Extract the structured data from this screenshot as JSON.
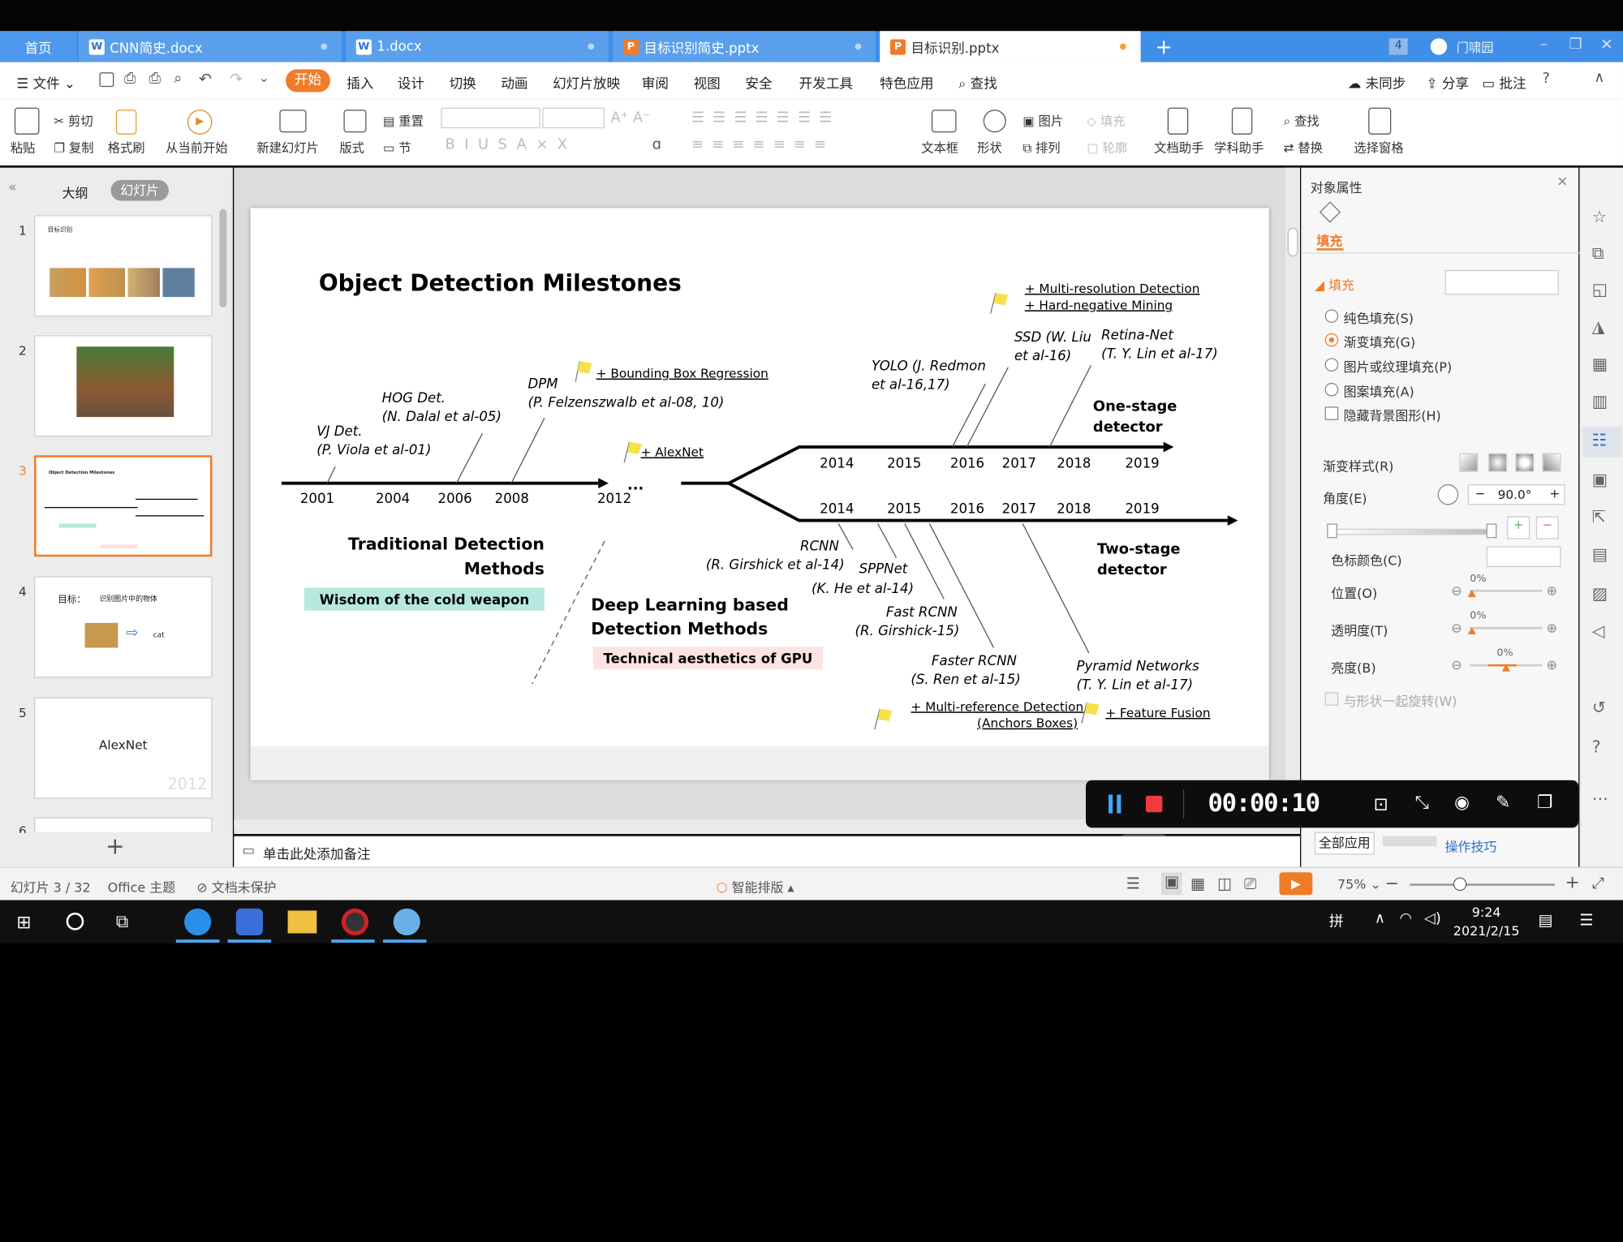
{
  "tabs": [
    {
      "label": "首页"
    },
    {
      "label": "CNN简史.docx"
    },
    {
      "label": "1.docx"
    },
    {
      "label": "目标识别简史.pptx"
    },
    {
      "label": "目标识别.pptx"
    }
  ],
  "window": {
    "tab_count": "4",
    "user": "门啸园"
  },
  "menu": [
    "文件",
    "开始",
    "插入",
    "设计",
    "切换",
    "动画",
    "幻灯片放映",
    "审阅",
    "视图",
    "安全",
    "开发工具",
    "特色应用",
    "查找"
  ],
  "menu_right": [
    "未同步",
    "分享",
    "批注"
  ],
  "ribbon": {
    "paste": "粘贴",
    "cut": "剪切",
    "copy": "复制",
    "format_brush": "格式刷",
    "from_current": "从当前开始",
    "new_slide": "新建幻灯片",
    "layout": "版式",
    "reset": "重置",
    "section": "节",
    "picture": "图片",
    "fill": "填充",
    "arrange": "排列",
    "outline": "轮廓",
    "textbox": "文本框",
    "shape": "形状",
    "doc_assist": "文档助手",
    "study_assist": "学科助手",
    "find": "查找",
    "replace": "替换",
    "select_pane": "选择窗格"
  },
  "left_panel": {
    "tab_outline": "大纲",
    "tab_slides": "幻灯片",
    "slides": [
      {
        "num": "1",
        "title": "目标识别"
      },
      {
        "num": "2",
        "title": ""
      },
      {
        "num": "3",
        "title": "Object Detection Milestones"
      },
      {
        "num": "4",
        "title": "目标：",
        "text": "识别图片中的物体",
        "label": "cat"
      },
      {
        "num": "5",
        "title": "AlexNet",
        "year": "2012"
      },
      {
        "num": "6"
      }
    ]
  },
  "slide": {
    "title": "Object Detection Milestones",
    "top_axis_years": [
      "2001",
      "2004",
      "2006",
      "2008",
      "2012",
      "..."
    ],
    "upper_branch_years": [
      "2014",
      "2015",
      "2016",
      "2017",
      "2018",
      "2019"
    ],
    "lower_branch_years": [
      "2014",
      "2015",
      "2016",
      "2017",
      "2018",
      "2019"
    ],
    "vj": [
      "VJ Det.",
      "(P. Viola et al-01)"
    ],
    "hog": [
      "HOG Det.",
      "(N. Dalal et al-05)"
    ],
    "dpm": [
      "DPM",
      "(P. Felzenszwalb et al-08, 10)"
    ],
    "bbox_reg": "+ Bounding Box Regression",
    "alexnet": "+ AlexNet",
    "yolo": [
      "YOLO (J. Redmon",
      "et al-16,17)"
    ],
    "ssd": [
      "SSD (W. Liu",
      "et al-16)"
    ],
    "retinanet": [
      "Retina-Net",
      "(T. Y. Lin et al-17)"
    ],
    "multires": [
      "+ Multi-resolution Detection",
      "+ Hard-negative Mining"
    ],
    "one_stage": [
      "One-stage",
      "detector"
    ],
    "two_stage": [
      "Two-stage",
      "detector"
    ],
    "traditional": [
      "Traditional Detection",
      "Methods"
    ],
    "cold_weapon": "Wisdom of the cold weapon",
    "deep": [
      "Deep Learning based",
      "Detection Methods"
    ],
    "gpu": "Technical aesthetics of GPU",
    "rcnn": [
      "RCNN",
      "(R. Girshick et al-14)"
    ],
    "sppnet": [
      "SPPNet",
      "(K. He et al-14)"
    ],
    "fast_rcnn": [
      "Fast RCNN",
      "(R. Girshick-15)"
    ],
    "faster_rcnn": [
      "Faster RCNN",
      "(S. Ren et al-15)"
    ],
    "fpn": [
      "Pyramid Networks",
      "(T. Y. Lin et al-17)"
    ],
    "multiref": [
      "+ Multi-reference Detection",
      "(Anchors Boxes)"
    ],
    "feature_fusion": "+ Feature Fusion"
  },
  "props": {
    "header": "对象属性",
    "tab": "填充",
    "section": "填充",
    "options": [
      "纯色填充(S)",
      "渐变填充(G)",
      "图片或纹理填充(P)",
      "图案填充(A)"
    ],
    "selected_option": 1,
    "hide_bg": "隐藏背景图形(H)",
    "gradient_style": "渐变样式(R)",
    "angle_label": "角度(E)",
    "angle_value": "90.0°",
    "stop_color": "色标颜色(C)",
    "position": "位置(O)",
    "position_value": "0%",
    "transparency": "透明度(T)",
    "transparency_value": "0%",
    "brightness": "亮度(B)",
    "brightness_value": "0%",
    "rotate_with_shape": "与形状一起旋转(W)",
    "apply_all": "全部应用",
    "tips": "操作技巧"
  },
  "recorder": {
    "time": "00:00:10",
    "tooltip": "暂停"
  },
  "notes_placeholder": "单击此处添加备注",
  "status": {
    "slide_count": "幻灯片 3 / 32",
    "theme": "Office 主题",
    "protect": "文档未保护",
    "smart": "智能排版",
    "zoom": "75%"
  },
  "taskbar": {
    "ime": "拼",
    "time": "9:24",
    "date": "2021/2/15"
  },
  "colors": {
    "accent": "#f07c2a",
    "tabbar": "#3f8ee8",
    "badge_cyan": "#b7e8e0",
    "badge_pink": "#fde3e3"
  }
}
